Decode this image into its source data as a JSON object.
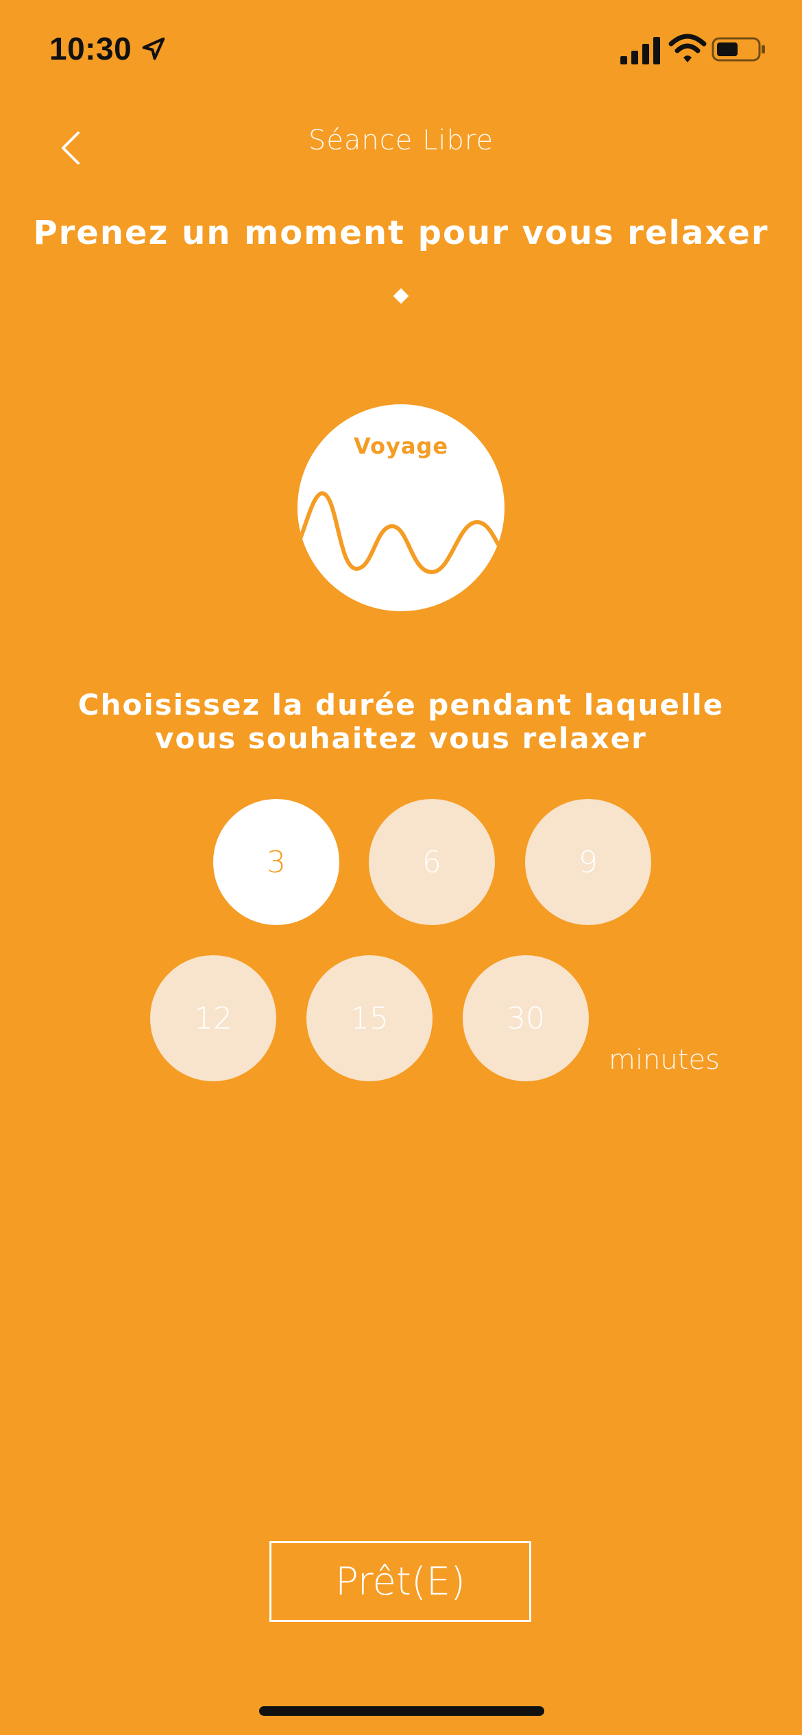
{
  "status_bar": {
    "time": "10:30",
    "icons": [
      "location-arrow-icon",
      "cellular-signal-icon",
      "wifi-icon",
      "battery-icon"
    ]
  },
  "nav": {
    "title": "Séance Libre",
    "back_icon": "chevron-left-icon"
  },
  "headline": "Prenez un moment pour vous relaxer",
  "mode": {
    "label": "Voyage",
    "icon": "wave-icon"
  },
  "prompt": {
    "line1": "Choisissez la durée pendant laquelle",
    "line2": "vous souhaitez vous relaxer"
  },
  "durations": {
    "options": [
      "3",
      "6",
      "9",
      "12",
      "15",
      "30"
    ],
    "selected": "3",
    "unit_label": "minutes"
  },
  "ready_button": {
    "label": "Prêt(E)"
  },
  "colors": {
    "background": "#F59C24",
    "option_inactive": "#F8E4CC",
    "option_active": "#FFFFFF",
    "text": "#FFFFFF"
  }
}
